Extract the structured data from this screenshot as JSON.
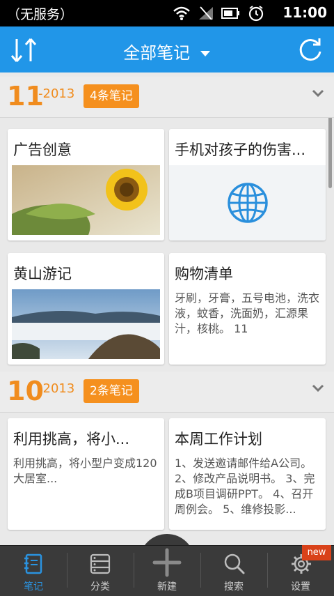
{
  "status": {
    "carrier": "（无服务）",
    "time": "11:00"
  },
  "header": {
    "title": "全部笔记"
  },
  "sections": [
    {
      "month": "11",
      "year": "-2013",
      "badge": "4条笔记",
      "cards": [
        {
          "title": "广告创意",
          "kind": "image",
          "image": "sunflower"
        },
        {
          "title": "手机对孩子的伤害...",
          "kind": "link",
          "icon": "globe-icon"
        },
        {
          "title": "黄山游记",
          "kind": "image",
          "image": "sea-of-clouds"
        },
        {
          "title": "购物清单",
          "kind": "text",
          "body": "牙刷，牙膏，五号电池，洗衣液，蚊香，洗面奶，汇源果汁，核桃。 11"
        }
      ]
    },
    {
      "month": "10",
      "year": "-2013",
      "badge": "2条笔记",
      "cards": [
        {
          "title": "利用挑高，将小...",
          "kind": "text",
          "body": "利用挑高，将小型户变成120大居室..."
        },
        {
          "title": "本周工作计划",
          "kind": "text",
          "body": "1、发送邀请邮件给A公司。2、修改产品说明书。 3、完成B项目调研PPT。 4、召开周例会。 5、维修投影..."
        }
      ]
    }
  ],
  "nav": [
    {
      "label": "笔记",
      "icon": "note-icon",
      "active": true
    },
    {
      "label": "分类",
      "icon": "category-icon",
      "active": false
    },
    {
      "label": "新建",
      "icon": "plus-icon",
      "active": false
    },
    {
      "label": "搜索",
      "icon": "search-icon",
      "active": false
    },
    {
      "label": "设置",
      "icon": "gear-icon",
      "active": false
    }
  ],
  "new_badge": "new",
  "colors": {
    "accent": "#2196e8",
    "orange": "#f08c1e",
    "nav_bg": "#3a3a3a",
    "active": "#2a93e0",
    "badge_red": "#d9421a"
  }
}
